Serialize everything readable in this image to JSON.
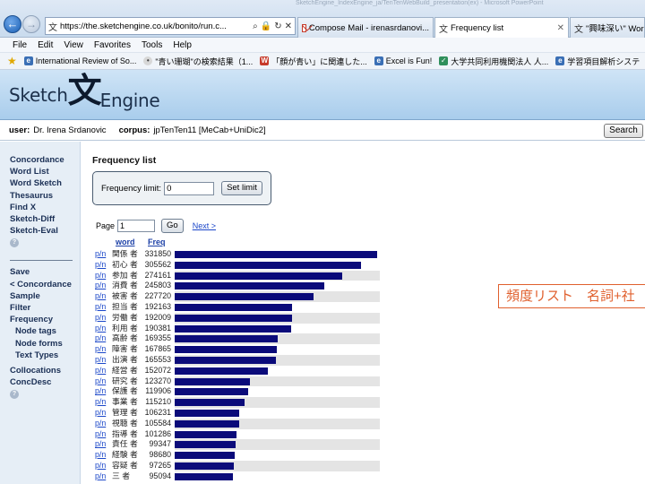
{
  "browser": {
    "title_strip": "SketchEngine_IndexEngine_ja/TenTenWebBuild_presentation(ex) - Microsoft PowerPoint",
    "address": "https://the.sketchengine.co.uk/bonito/run.c...",
    "tabs": [
      {
        "label": "Compose Mail - irenasrdanovi...",
        "icon": "gmail-icon"
      },
      {
        "label": "Frequency list",
        "icon": "sketchengine-icon",
        "active": true
      },
      {
        "label": "\"興味深い\" Word",
        "icon": "sketchengine-icon"
      }
    ],
    "menu": [
      "File",
      "Edit",
      "View",
      "Favorites",
      "Tools",
      "Help"
    ],
    "favorites": [
      "International Review of So...",
      "\"青い珊瑚\"の検索結果（1...",
      "「顔が青い」に関連した...",
      "Excel is Fun!",
      "大学共同利用機関法人 人...",
      "学習項目解析システ"
    ]
  },
  "header": {
    "logo_left": "Sketch",
    "logo_kanji": "文",
    "logo_right": "Engine",
    "user_label": "user:",
    "user_value": "Dr. Irena Srdanovic",
    "corpus_label": "corpus:",
    "corpus_value": "jpTenTen11 [MeCab+UniDic2]",
    "search_button": "Search"
  },
  "sidebar": {
    "group1": [
      "Concordance",
      "Word List",
      "Word Sketch",
      "Thesaurus",
      "Find X",
      "Sketch-Diff",
      "Sketch-Eval"
    ],
    "group2": [
      "Save",
      "< Concordance",
      "Sample",
      "Filter",
      "Frequency"
    ],
    "group2_sub": [
      "Node tags",
      "Node forms",
      "Text Types"
    ],
    "group3": [
      "Collocations",
      "ConcDesc"
    ],
    "help_glyph": "?"
  },
  "main": {
    "heading": "Frequency list",
    "limit_label": "Frequency limit:",
    "limit_value": "0",
    "set_limit_button": "Set limit",
    "page_label": "Page",
    "page_value": "1",
    "go_button": "Go",
    "next_link": "Next >",
    "col_word": "word",
    "col_freq": "Freq",
    "pn_link": "p/n"
  },
  "annotation": "頻度リスト　名詞+社",
  "colors": {
    "bar": "#0b0b7a",
    "link": "#1b47c9",
    "annotation": "#e0602e",
    "header_bg": "#a9cdec"
  },
  "chart_data": {
    "type": "bar",
    "categories": [
      "関係 者",
      "初心 者",
      "参加 者",
      "消費 者",
      "被害 者",
      "担当 者",
      "労働 者",
      "利用 者",
      "高齢 者",
      "障害 者",
      "出演 者",
      "経営 者",
      "研究 者",
      "保護 者",
      "事業 者",
      "管理 者",
      "視聴 者",
      "指導 者",
      "責任 者",
      "経験 者",
      "容疑 者",
      "三 者"
    ],
    "values": [
      331850,
      305562,
      274161,
      245803,
      227720,
      192163,
      192009,
      190381,
      169355,
      167865,
      165553,
      152072,
      123270,
      119906,
      115210,
      106231,
      105584,
      101286,
      99347,
      98680,
      97265,
      95094
    ],
    "xlabel": "word",
    "ylabel": "Freq"
  }
}
